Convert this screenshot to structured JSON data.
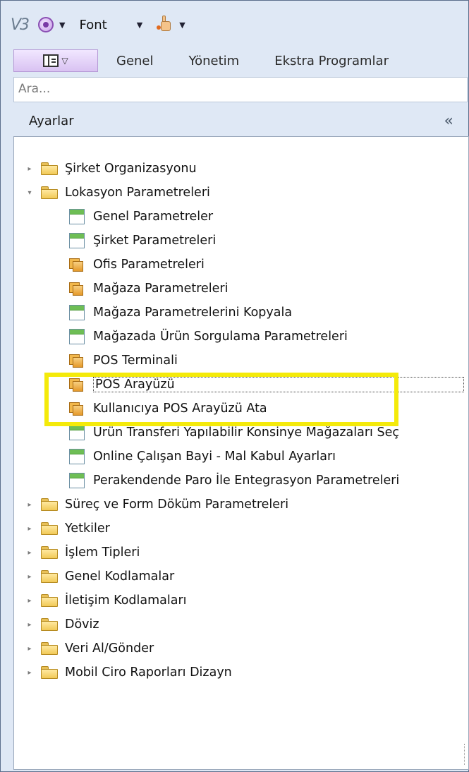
{
  "toolbar": {
    "logo": "V3",
    "font_label": "Font",
    "arrow": "▼"
  },
  "ribbon": {
    "tabs": [
      "Genel",
      "Yönetim",
      "Ekstra Programlar"
    ]
  },
  "search": {
    "placeholder": "Ara..."
  },
  "panel": {
    "title": "Ayarlar",
    "collapse": "«"
  },
  "tree": {
    "items": [
      {
        "label": "Şirket Organizasyonu",
        "type": "folder",
        "expander": "▸"
      },
      {
        "label": "Lokasyon Parametreleri",
        "type": "folder",
        "expander": "▾"
      },
      {
        "label": "Genel Parametreler",
        "type": "form"
      },
      {
        "label": "Şirket Parametreleri",
        "type": "form"
      },
      {
        "label": "Ofis Parametreleri",
        "type": "stack"
      },
      {
        "label": "Mağaza Parametreleri",
        "type": "stack"
      },
      {
        "label": "Mağaza Parametrelerini Kopyala",
        "type": "form"
      },
      {
        "label": "Mağazada Ürün Sorgulama Parametreleri",
        "type": "form"
      },
      {
        "label": "POS Terminali",
        "type": "stack"
      },
      {
        "label": "POS Arayüzü",
        "type": "stack"
      },
      {
        "label": "Kullanıcıya POS Arayüzü Ata",
        "type": "stack"
      },
      {
        "label": "Ürün Transferi Yapılabilir Konsinye Mağazaları Seç",
        "type": "form"
      },
      {
        "label": "Online Çalışan Bayi - Mal Kabul Ayarları",
        "type": "form"
      },
      {
        "label": "Perakendende Paro İle Entegrasyon Parametreleri",
        "type": "form"
      },
      {
        "label": "Süreç ve Form Döküm Parametreleri",
        "type": "folder",
        "expander": "▸"
      },
      {
        "label": "Yetkiler",
        "type": "folder",
        "expander": "▸"
      },
      {
        "label": "İşlem Tipleri",
        "type": "folder",
        "expander": "▸"
      },
      {
        "label": "Genel Kodlamalar",
        "type": "folder",
        "expander": "▸"
      },
      {
        "label": "İletişim Kodlamaları",
        "type": "folder",
        "expander": "▸"
      },
      {
        "label": "Döviz",
        "type": "folder",
        "expander": "▸"
      },
      {
        "label": "Veri Al/Gönder",
        "type": "folder",
        "expander": "▸"
      },
      {
        "label": "Mobil Ciro Raporları Dizayn",
        "type": "folder",
        "expander": "▸"
      }
    ]
  },
  "colors": {
    "highlight": "#f4ea0a",
    "frame_bg": "#dfe8f5"
  }
}
